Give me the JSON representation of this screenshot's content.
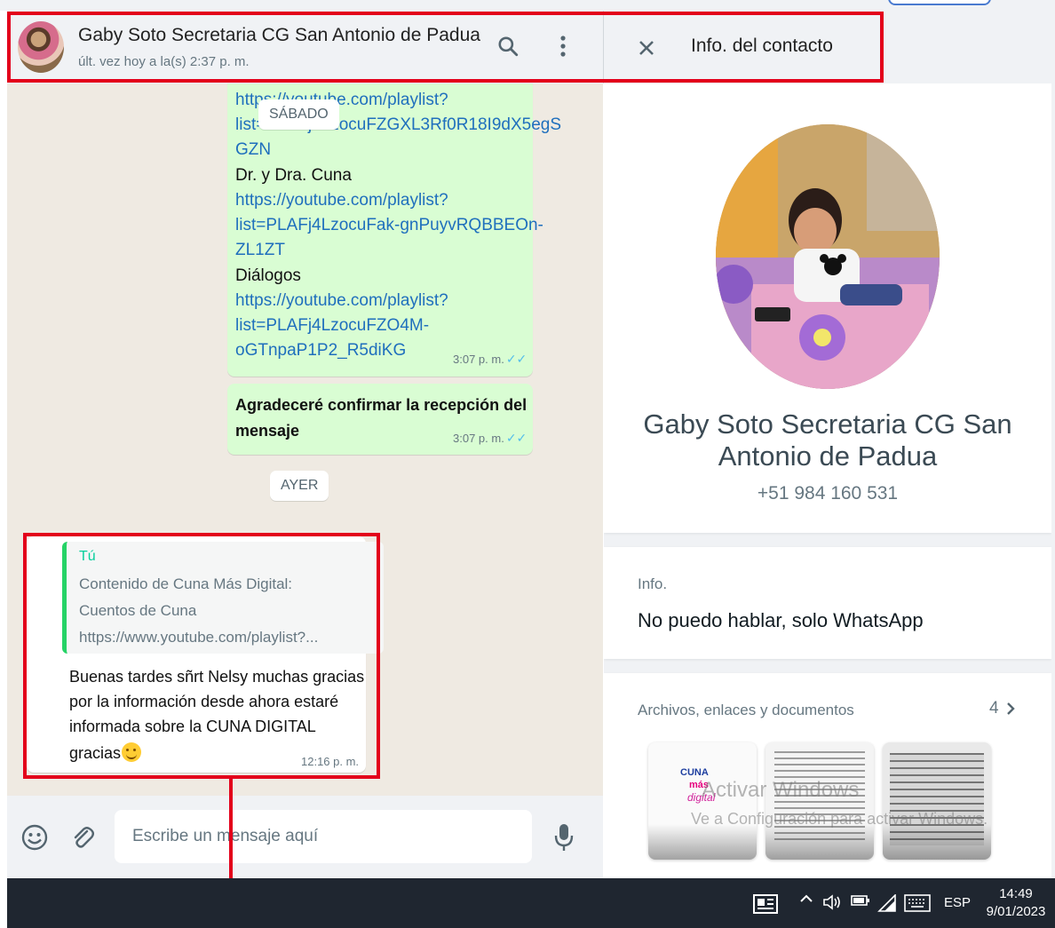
{
  "chat": {
    "contact_name": "Gaby Soto Secretaria CG San Antonio de Padua",
    "last_seen": "últ. vez hoy a la(s) 2:37 p. m."
  },
  "info_header": {
    "title": "Info. del contacto"
  },
  "messages": {
    "date_saturday": "SÁBADO",
    "date_yesterday": "AYER",
    "links_bubble": {
      "lines": [
        "https://youtube.com/playlist?",
        "list=PLAFj4LzocuFZGXL3Rf0R18I9dX5egS",
        "GZN",
        "Dr. y Dra. Cuna",
        "https://youtube.com/playlist?",
        "list=PLAFj4LzocuFak-gnPuyvRQBBEOn-",
        "ZL1ZT",
        "Diálogos",
        "https://youtube.com/playlist?",
        "list=PLAFj4LzocuFZO4M-",
        "oGTnpaP1P2_R5diKG"
      ],
      "time": "3:07 p. m."
    },
    "bold_bubble": {
      "lines": [
        "Agradeceré confirmar la recepción del",
        "mensaje"
      ],
      "time": "3:07 p. m."
    },
    "reply_bubble": {
      "quote_author": "Tú",
      "quote_lines": [
        "Contenido de Cuna Más Digital:",
        "Cuentos de Cuna",
        "https://www.youtube.com/playlist?..."
      ],
      "lines": [
        "Buenas tardes sñrt Nelsy muchas gracias",
        "por la información desde ahora estaré",
        "informada sobre la CUNA DIGITAL",
        "gracias"
      ],
      "time": "12:16 p. m."
    }
  },
  "composer": {
    "placeholder": "Escribe un mensaje aquí"
  },
  "contact_info": {
    "name_line1": "Gaby Soto Secretaria CG San",
    "name_line2": "Antonio de Padua",
    "phone": "+51 984 160 531",
    "about_label": "Info.",
    "about_text": "No puedo hablar, solo WhatsApp",
    "media_label": "Archivos, enlaces y documentos",
    "media_count": "4",
    "thumb_logo": [
      "CUNA",
      "más",
      "digital"
    ]
  },
  "watermark": {
    "line1": "Activar Windows",
    "line2": "Ve a Configuración para activar Windows."
  },
  "taskbar": {
    "lang": "ESP",
    "time": "14:49",
    "date": "9/01/2023"
  },
  "colors": {
    "accent_red": "#e3001b",
    "outgoing_bubble": "#d9fdd3",
    "link": "#1f6fbd",
    "read_tick": "#53bdeb",
    "quote_bar": "#25d366"
  },
  "icons": {
    "search": "search-icon",
    "menu": "kebab-menu-icon",
    "close": "close-icon",
    "emoji": "emoji-icon",
    "attach": "paperclip-icon",
    "mic": "microphone-icon",
    "scroll_down": "chevron-down-icon",
    "media_more": "chevron-right-icon"
  }
}
